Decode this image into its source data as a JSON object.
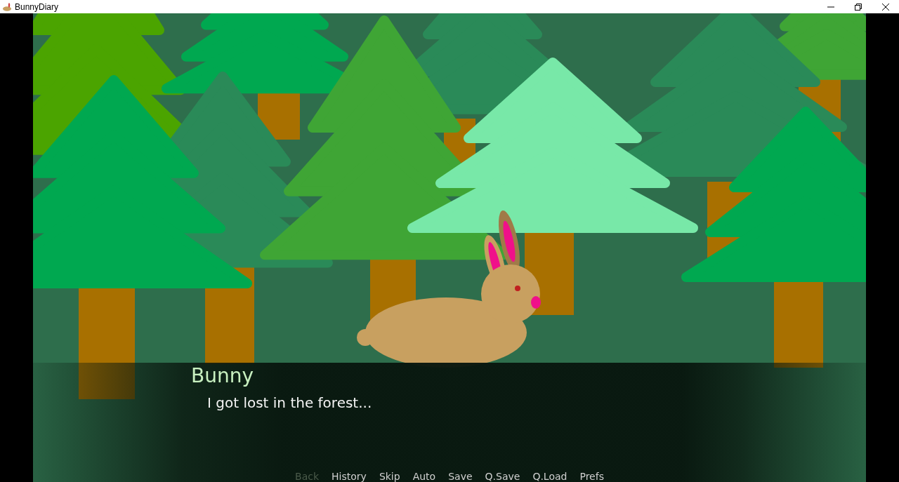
{
  "window": {
    "title": "BunnyDiary"
  },
  "dialogue": {
    "speaker": "Bunny",
    "text": "I got lost in the forest..."
  },
  "quick_menu": [
    {
      "label": "Back",
      "disabled": true
    },
    {
      "label": "History",
      "disabled": false
    },
    {
      "label": "Skip",
      "disabled": false
    },
    {
      "label": "Auto",
      "disabled": false
    },
    {
      "label": "Save",
      "disabled": false
    },
    {
      "label": "Q.Save",
      "disabled": false
    },
    {
      "label": "Q.Load",
      "disabled": false
    },
    {
      "label": "Prefs",
      "disabled": false
    }
  ]
}
